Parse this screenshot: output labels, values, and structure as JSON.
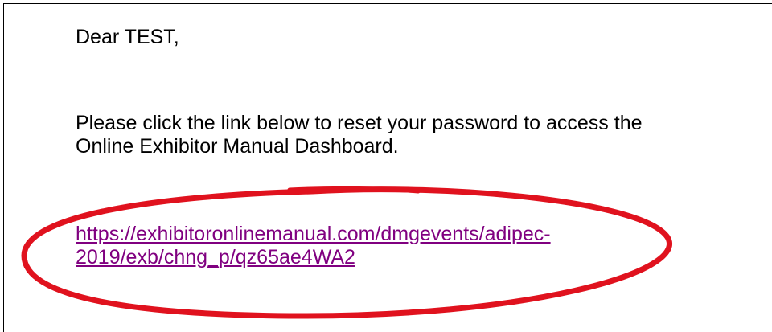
{
  "email": {
    "greeting": "Dear TEST,",
    "instruction_line1": "Please click the link below to reset your password to access the",
    "instruction_line2": "Online Exhibitor Manual Dashboard.",
    "link_line1": "https://exhibitoronlinemanual.com/dmgevents/adipec-",
    "link_line2": "2019/exb/chng_p/qz65ae4WA2"
  },
  "colors": {
    "link": "#800080",
    "annotation_circle": "#e0121e",
    "text": "#000000"
  }
}
